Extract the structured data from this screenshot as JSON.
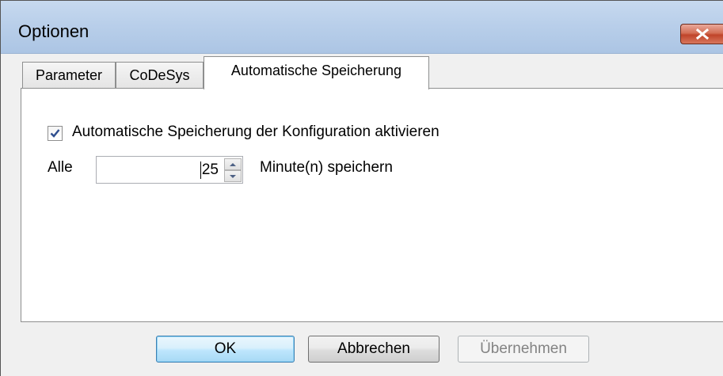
{
  "window": {
    "title": "Optionen"
  },
  "tabs": [
    {
      "label": "Parameter",
      "active": false
    },
    {
      "label": "CoDeSys",
      "active": false
    },
    {
      "label": "Automatische Speicherung",
      "active": true
    }
  ],
  "autosave": {
    "checkbox_label": "Automatische Speicherung der Konfiguration aktivieren",
    "checked": true,
    "prefix_label": "Alle",
    "interval_value": "25",
    "suffix_label": "Minute(n) speichern"
  },
  "buttons": {
    "ok": "OK",
    "cancel": "Abbrechen",
    "apply": "Übernehmen"
  },
  "colors": {
    "titlebar": "#b9cfea",
    "close_button": "#c7432a",
    "default_button_border": "#3c7fb1"
  },
  "icons": {
    "close": "close-icon",
    "check": "checkmark-icon",
    "spin_up": "arrow-up-icon",
    "spin_down": "arrow-down-icon"
  }
}
